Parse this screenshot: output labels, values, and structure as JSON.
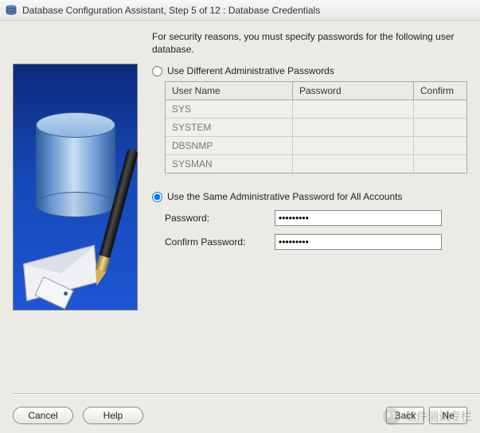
{
  "window": {
    "title": "Database Configuration Assistant, Step 5 of 12 : Database Credentials"
  },
  "intro": "For security reasons, you must specify passwords for the following user database.",
  "radios": {
    "different": "Use Different Administrative Passwords",
    "same": "Use the Same Administrative Password for All Accounts"
  },
  "table": {
    "headers": {
      "username": "User Name",
      "password": "Password",
      "confirm": "Confirm "
    },
    "rows": [
      {
        "username": "SYS",
        "password": "",
        "confirm": ""
      },
      {
        "username": "SYSTEM",
        "password": "",
        "confirm": ""
      },
      {
        "username": "DBSNMP",
        "password": "",
        "confirm": ""
      },
      {
        "username": "SYSMAN",
        "password": "",
        "confirm": ""
      }
    ]
  },
  "fields": {
    "password_label": "Password:",
    "password_value": "*********",
    "confirm_label": "Confirm Password:",
    "confirm_value": "*********"
  },
  "buttons": {
    "cancel": "Cancel",
    "help": "Help",
    "back": "Back",
    "next": "Ne"
  },
  "watermark": "软件测试专栏"
}
